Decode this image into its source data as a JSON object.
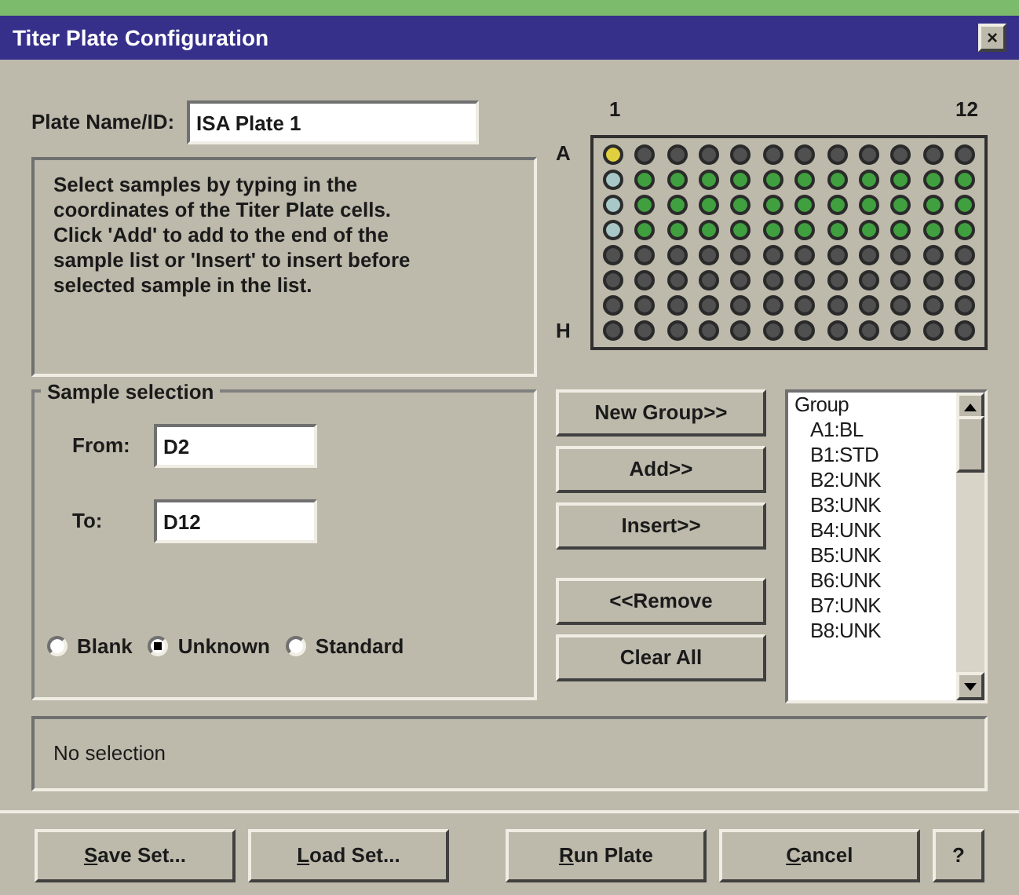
{
  "window": {
    "title": "Titer Plate Configuration",
    "close": "×"
  },
  "plate_name": {
    "label": "Plate Name/ID:",
    "value": "ISA Plate 1"
  },
  "instructions": "Select samples by typing in the coordinates of the Titer Plate cells. Click 'Add' to add to the end of the sample list or 'Insert' to insert before selected sample in the list.",
  "plate": {
    "first_column": "1",
    "last_column": "12",
    "first_row": "A",
    "last_row": "H",
    "rows": [
      {
        "wells": [
          {
            "color": "#e0d040"
          },
          {
            "color": "#505050"
          },
          {
            "color": "#505050"
          },
          {
            "color": "#505050"
          },
          {
            "color": "#505050"
          },
          {
            "color": "#505050"
          },
          {
            "color": "#505050"
          },
          {
            "color": "#505050"
          },
          {
            "color": "#505050"
          },
          {
            "color": "#505050"
          },
          {
            "color": "#505050"
          },
          {
            "color": "#505050"
          }
        ]
      },
      {
        "wells": [
          {
            "color": "#a8c8c8"
          },
          {
            "color": "#40a040"
          },
          {
            "color": "#40a040"
          },
          {
            "color": "#40a040"
          },
          {
            "color": "#40a040"
          },
          {
            "color": "#40a040"
          },
          {
            "color": "#40a040"
          },
          {
            "color": "#40a040"
          },
          {
            "color": "#40a040"
          },
          {
            "color": "#40a040"
          },
          {
            "color": "#40a040"
          },
          {
            "color": "#40a040"
          }
        ]
      },
      {
        "wells": [
          {
            "color": "#a8c8c8"
          },
          {
            "color": "#40a040"
          },
          {
            "color": "#40a040"
          },
          {
            "color": "#40a040"
          },
          {
            "color": "#40a040"
          },
          {
            "color": "#40a040"
          },
          {
            "color": "#40a040"
          },
          {
            "color": "#40a040"
          },
          {
            "color": "#40a040"
          },
          {
            "color": "#40a040"
          },
          {
            "color": "#40a040"
          },
          {
            "color": "#40a040"
          }
        ]
      },
      {
        "wells": [
          {
            "color": "#a8c8c8"
          },
          {
            "color": "#40a040"
          },
          {
            "color": "#40a040"
          },
          {
            "color": "#40a040"
          },
          {
            "color": "#40a040"
          },
          {
            "color": "#40a040"
          },
          {
            "color": "#40a040"
          },
          {
            "color": "#40a040"
          },
          {
            "color": "#40a040"
          },
          {
            "color": "#40a040"
          },
          {
            "color": "#40a040"
          },
          {
            "color": "#40a040"
          }
        ]
      },
      {
        "wells": [
          {
            "color": "#505050"
          },
          {
            "color": "#505050"
          },
          {
            "color": "#505050"
          },
          {
            "color": "#505050"
          },
          {
            "color": "#505050"
          },
          {
            "color": "#505050"
          },
          {
            "color": "#505050"
          },
          {
            "color": "#505050"
          },
          {
            "color": "#505050"
          },
          {
            "color": "#505050"
          },
          {
            "color": "#505050"
          },
          {
            "color": "#505050"
          }
        ]
      },
      {
        "wells": [
          {
            "color": "#505050"
          },
          {
            "color": "#505050"
          },
          {
            "color": "#505050"
          },
          {
            "color": "#505050"
          },
          {
            "color": "#505050"
          },
          {
            "color": "#505050"
          },
          {
            "color": "#505050"
          },
          {
            "color": "#505050"
          },
          {
            "color": "#505050"
          },
          {
            "color": "#505050"
          },
          {
            "color": "#505050"
          },
          {
            "color": "#505050"
          }
        ]
      },
      {
        "wells": [
          {
            "color": "#505050"
          },
          {
            "color": "#505050"
          },
          {
            "color": "#505050"
          },
          {
            "color": "#505050"
          },
          {
            "color": "#505050"
          },
          {
            "color": "#505050"
          },
          {
            "color": "#505050"
          },
          {
            "color": "#505050"
          },
          {
            "color": "#505050"
          },
          {
            "color": "#505050"
          },
          {
            "color": "#505050"
          },
          {
            "color": "#505050"
          }
        ]
      },
      {
        "wells": [
          {
            "color": "#505050"
          },
          {
            "color": "#505050"
          },
          {
            "color": "#505050"
          },
          {
            "color": "#505050"
          },
          {
            "color": "#505050"
          },
          {
            "color": "#505050"
          },
          {
            "color": "#505050"
          },
          {
            "color": "#505050"
          },
          {
            "color": "#505050"
          },
          {
            "color": "#505050"
          },
          {
            "color": "#505050"
          },
          {
            "color": "#505050"
          }
        ]
      }
    ]
  },
  "sample_selection": {
    "title": "Sample selection",
    "from": {
      "label": "From:",
      "value": "D2"
    },
    "to": {
      "label": "To:",
      "value": "D12"
    },
    "types": [
      {
        "label": "Blank",
        "selected": false
      },
      {
        "label": "Unknown",
        "selected": true
      },
      {
        "label": "Standard",
        "selected": false
      }
    ]
  },
  "action_groups": [
    {
      "buttons": [
        "New Group>>",
        "Add>>",
        "Insert>>"
      ]
    },
    {
      "buttons": [
        "<<Remove",
        "Clear All"
      ]
    }
  ],
  "sample_list": {
    "items": [
      {
        "label": "Group",
        "children": [
          {
            "label": "A1:BL"
          },
          {
            "label": "B1:STD"
          },
          {
            "label": "B2:UNK"
          },
          {
            "label": "B3:UNK"
          },
          {
            "label": "B4:UNK"
          },
          {
            "label": "B5:UNK"
          },
          {
            "label": "B6:UNK"
          },
          {
            "label": "B7:UNK"
          },
          {
            "label": "B8:UNK"
          }
        ]
      }
    ]
  },
  "status": "No selection",
  "buttons": [
    {
      "label": "Save Set...",
      "underline_first": true
    },
    {
      "label": "Load Set...",
      "underline_first": true
    },
    {
      "label": "Run Plate",
      "underline_first": true
    },
    {
      "label": "Cancel",
      "underline_first": true
    },
    {
      "label": "?",
      "underline_first": false
    }
  ]
}
